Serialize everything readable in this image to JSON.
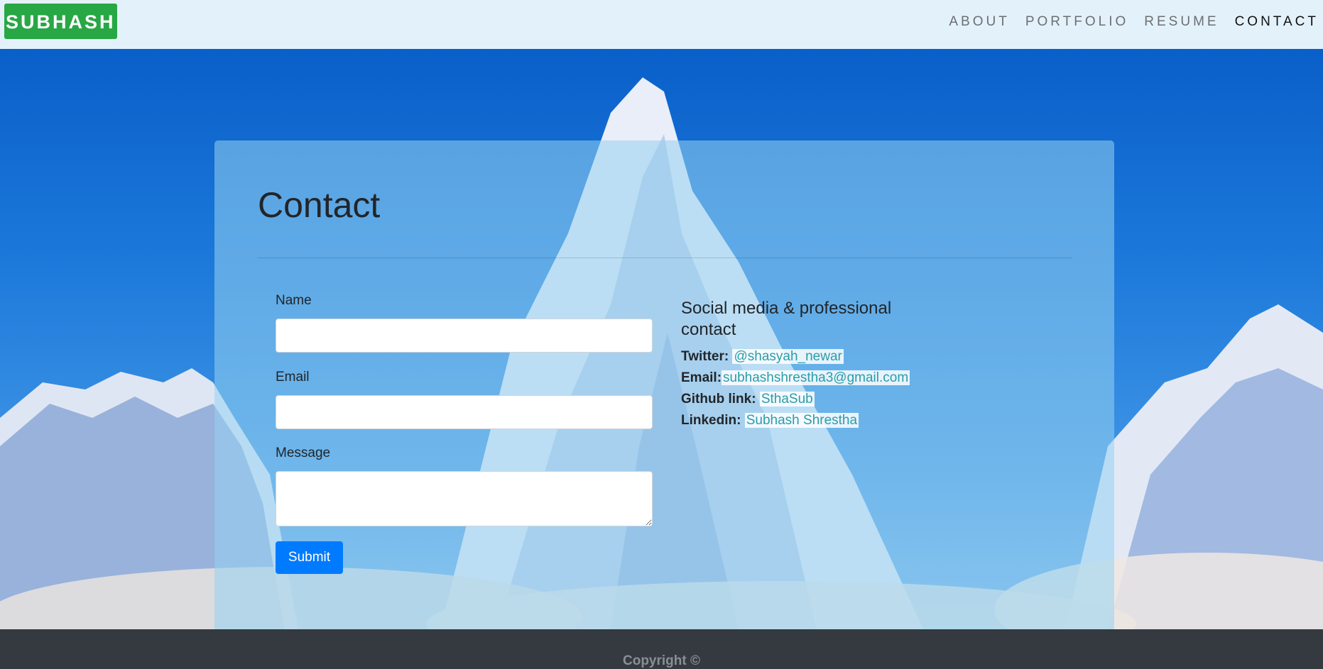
{
  "navbar": {
    "brand": "SUBHASH",
    "links": [
      "ABOUT",
      "PORTFOLIO",
      "RESUME",
      "CONTACT"
    ]
  },
  "contact": {
    "title": "Contact",
    "form": {
      "name_label": "Name",
      "name_value": "",
      "email_label": "Email",
      "email_value": "",
      "message_label": "Message",
      "message_value": "",
      "submit_label": "Submit"
    },
    "social": {
      "heading": "Social media & professional contact",
      "twitter_label": "Twitter:",
      "twitter_value": "@shasyah_newar",
      "email_label": "Email:",
      "email_value": "subhashshrestha3@gmail.com",
      "github_label": "Github link:",
      "github_value": "SthaSub",
      "linkedin_label": "Linkedin:",
      "linkedin_value": "Subhash Shrestha"
    }
  },
  "footer": {
    "text": "Copyright ©"
  },
  "colors": {
    "brand_bg": "#28a745",
    "navbar_bg": "#e3f1fb",
    "submit_bg": "#007bff",
    "link": "#2a9da8",
    "footer_bg": "#343a40"
  }
}
